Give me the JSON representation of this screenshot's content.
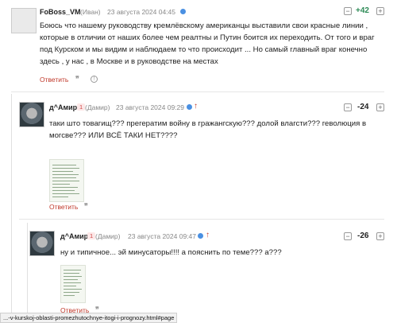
{
  "comments": [
    {
      "author": "FoBoss_VM",
      "username": "(Иван)",
      "date": "23 августа 2024 04:45",
      "score": "+42",
      "text": "Боюсь что нашему руководству кремлёвскому американцы выставили свои красные линии , которые в отличии от наших более чем реалтны и Путин боится их переходить. От того и враг под Курском и мы видим и наблюдаем то что происходит ... Но самый главный враг конечно здесь , у нас , в Москве и в руководстве на местах",
      "reply_label": "Ответить",
      "status_color": "#4a90e2"
    },
    {
      "author": "д^Амир",
      "badge": "1",
      "username": "(Дамир)",
      "date": "23 августа 2024 09:29",
      "score": "-24",
      "text": "таки што товагищ??? прегератим войну в гражангскую??? долой влагсти??? геволюция в могсве??? ИЛИ ВСЁ ТАКИ НЕТ????",
      "reply_label": "Ответить",
      "status_color": "#4a90e2"
    },
    {
      "author": "д^Амир",
      "badge": "1",
      "username": "(Дамир)",
      "date": "23 августа 2024 09:47",
      "score": "-26",
      "text": "ну и типичное... эй минусаторы!!!! а пояснить по теме??? а???",
      "reply_label": "Ответить",
      "status_color": "#4a90e2"
    }
  ],
  "icons": {
    "quote": "quote-icon",
    "warn": "complaint-icon",
    "arrow": "up-arrow-icon"
  },
  "colors": {
    "accent": "#c0392b",
    "positive": "#2e8b57",
    "negative": "#222222"
  },
  "status_url": "...-v-kurskoj-oblasti-promezhutochnye-itogi-i-prognozy.html#page"
}
